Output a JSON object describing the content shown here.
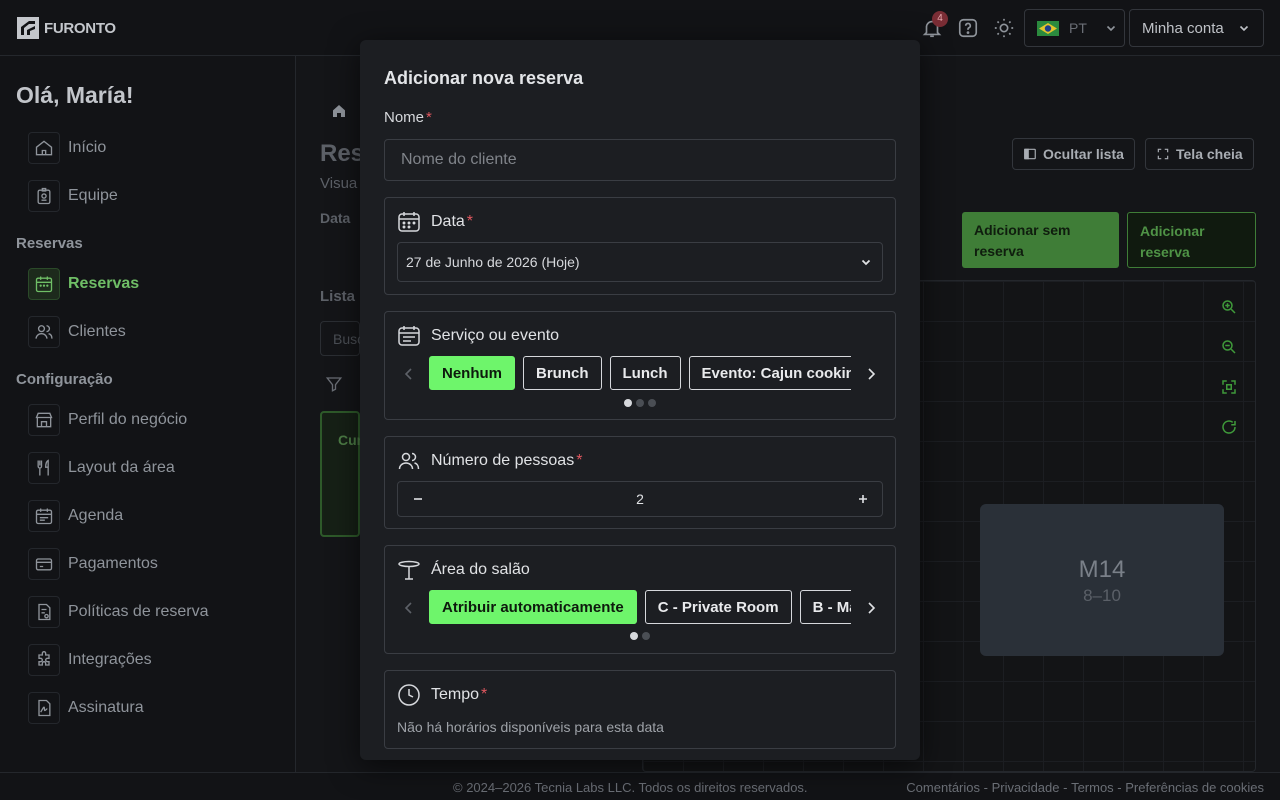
{
  "app": {
    "brand": "FURONTO",
    "notification_count": "4",
    "language": "PT",
    "account_label": "Minha conta"
  },
  "colors": {
    "accent": "#6ef56b",
    "accent_dark": "#3f7d37",
    "required": "#e0575f"
  },
  "sidebar": {
    "greeting": "Olá, María!",
    "items_top": [
      {
        "label": "Início",
        "icon": "home-icon"
      },
      {
        "label": "Equipe",
        "icon": "badge-icon"
      }
    ],
    "section_reservations": "Reservas",
    "items_reservations": [
      {
        "label": "Reservas",
        "icon": "calendar-icon",
        "active": true
      },
      {
        "label": "Clientes",
        "icon": "users-icon"
      }
    ],
    "section_config": "Configuração",
    "items_config": [
      {
        "label": "Perfil do negócio",
        "icon": "store-icon"
      },
      {
        "label": "Layout da área",
        "icon": "utensils-icon"
      },
      {
        "label": "Agenda",
        "icon": "schedule-icon"
      },
      {
        "label": "Pagamentos",
        "icon": "credit-card-icon"
      },
      {
        "label": "Políticas de reserva",
        "icon": "policy-icon"
      },
      {
        "label": "Integrações",
        "icon": "puzzle-icon"
      },
      {
        "label": "Assinatura",
        "icon": "signature-icon"
      }
    ]
  },
  "main": {
    "hide_list": "Ocultar lista",
    "fullscreen": "Tela cheia",
    "add_without_reservation": "Adicionar sem reserva",
    "add_reservation": "Adicionar reserva",
    "partial_title": "Res",
    "partial_subtitle": "Visua",
    "partial_date": "Data",
    "partial_list": "Lista",
    "partial_search": "Busc",
    "partial_card": "Cur",
    "table": {
      "name": "M14",
      "capacity": "8–10"
    }
  },
  "modal": {
    "title": "Adicionar nova reserva",
    "name_label": "Nome",
    "name_placeholder": "Nome do cliente",
    "date_label": "Data",
    "date_value": "27 de Junho de 2026 (Hoje)",
    "service_label": "Serviço ou evento",
    "service_options": [
      "Nenhum",
      "Brunch",
      "Lunch",
      "Evento: Cajun cooking"
    ],
    "people_label": "Número de pessoas",
    "people_value": "2",
    "area_label": "Área do salão",
    "area_options": [
      "Atribuir automaticamente",
      "C - Private Room",
      "B - Ma"
    ],
    "time_label": "Tempo",
    "time_empty": "Não há horários disponíveis para esta data"
  },
  "footer": {
    "copyright": "© 2024–2026 Tecnia Labs LLC. Todos os direitos reservados.",
    "links": [
      "Comentários",
      "Privacidade",
      "Termos",
      "Preferências de cookies"
    ],
    "separator": " - "
  }
}
